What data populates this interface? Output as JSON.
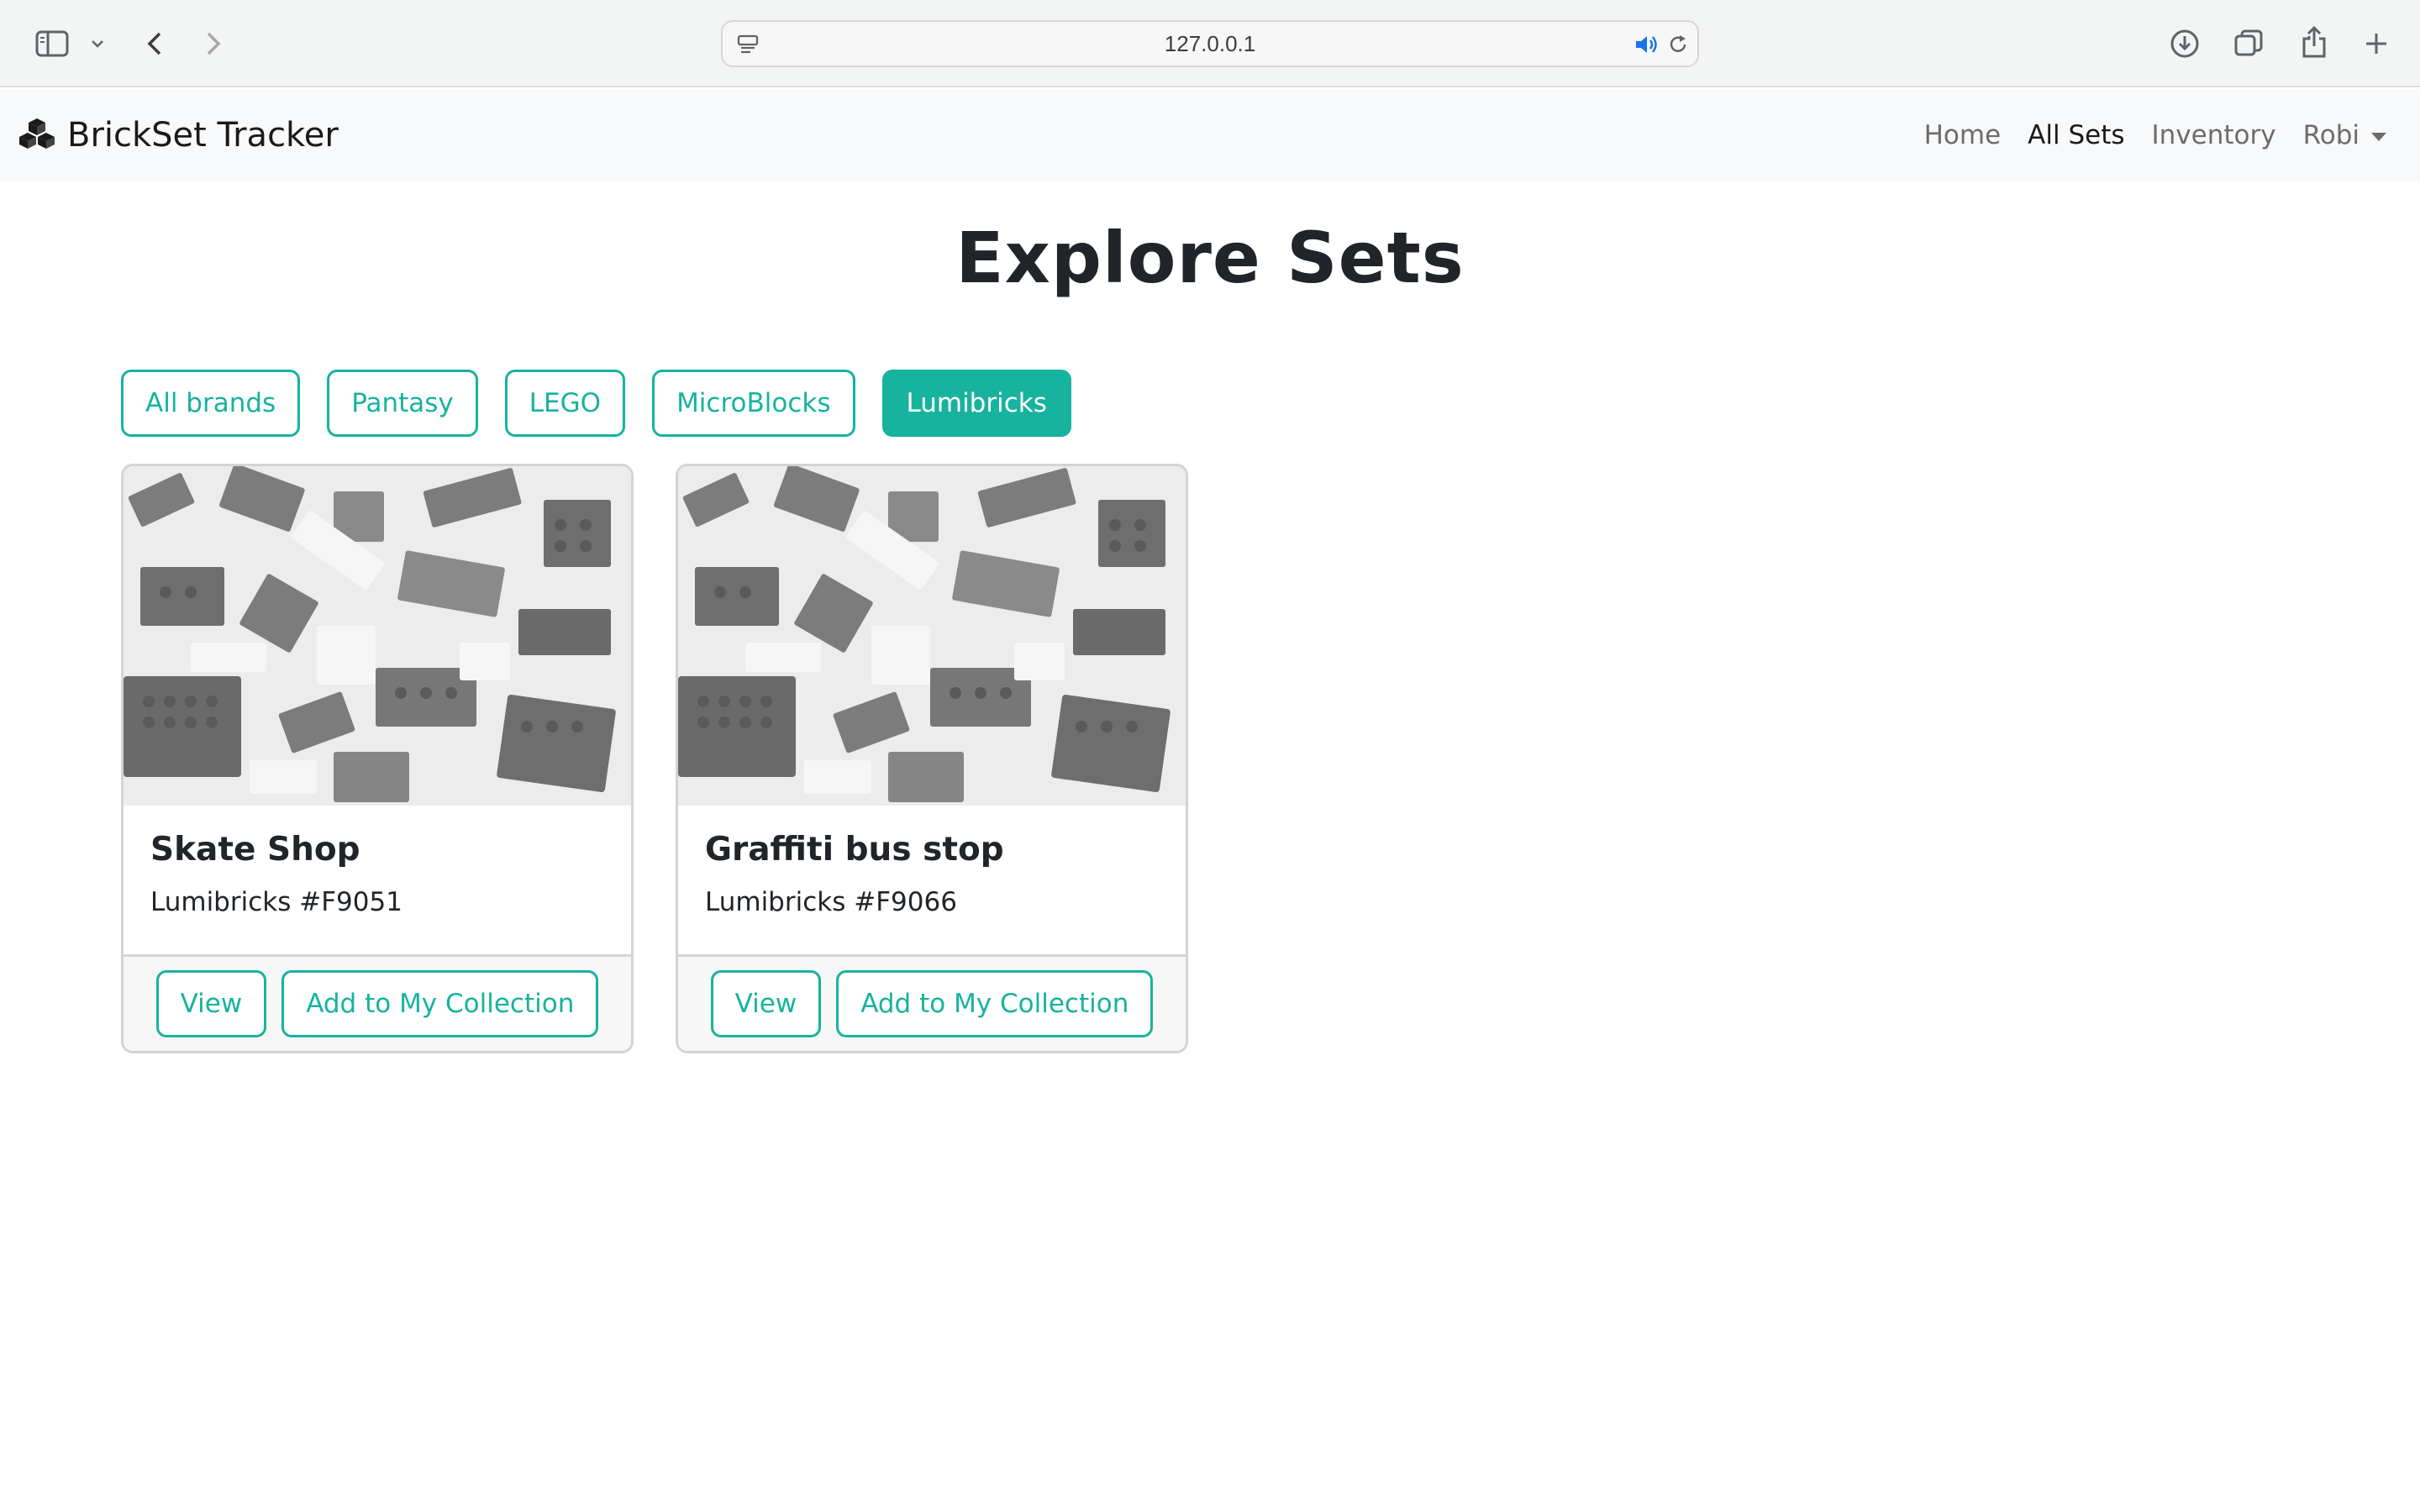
{
  "browser": {
    "address": "127.0.0.1"
  },
  "navbar": {
    "brand": "BrickSet Tracker",
    "links": [
      {
        "label": "Home",
        "active": false
      },
      {
        "label": "All Sets",
        "active": true
      },
      {
        "label": "Inventory",
        "active": false
      }
    ],
    "user": "Robi"
  },
  "page": {
    "title": "Explore Sets"
  },
  "filters": [
    {
      "label": "All brands",
      "active": false
    },
    {
      "label": "Pantasy",
      "active": false
    },
    {
      "label": "LEGO",
      "active": false
    },
    {
      "label": "MicroBlocks",
      "active": false
    },
    {
      "label": "Lumibricks",
      "active": true
    }
  ],
  "sets": [
    {
      "title": "Skate Shop",
      "subtitle": "Lumibricks #F9051",
      "view_label": "View",
      "add_label": "Add to My Collection"
    },
    {
      "title": "Graffiti bus stop",
      "subtitle": "Lumibricks #F9066",
      "view_label": "View",
      "add_label": "Add to My Collection"
    }
  ],
  "colors": {
    "accent": "#17b39e",
    "navbar_bg": "#f8f9fa",
    "text": "#212529"
  }
}
